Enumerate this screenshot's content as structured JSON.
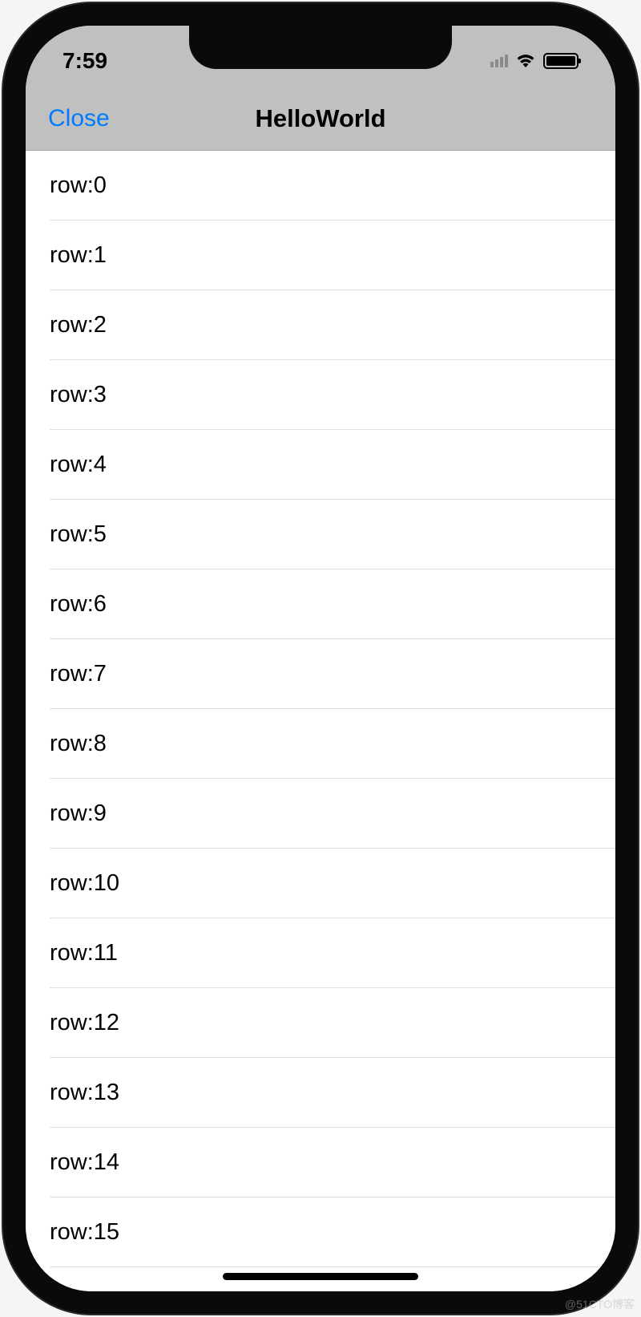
{
  "status": {
    "time": "7:59"
  },
  "nav": {
    "close_label": "Close",
    "title": "HelloWorld"
  },
  "table": {
    "rows": [
      {
        "label": "row:0"
      },
      {
        "label": "row:1"
      },
      {
        "label": "row:2"
      },
      {
        "label": "row:3"
      },
      {
        "label": "row:4"
      },
      {
        "label": "row:5"
      },
      {
        "label": "row:6"
      },
      {
        "label": "row:7"
      },
      {
        "label": "row:8"
      },
      {
        "label": "row:9"
      },
      {
        "label": "row:10"
      },
      {
        "label": "row:11"
      },
      {
        "label": "row:12"
      },
      {
        "label": "row:13"
      },
      {
        "label": "row:14"
      },
      {
        "label": "row:15"
      }
    ]
  },
  "watermark": "@51CTO博客"
}
